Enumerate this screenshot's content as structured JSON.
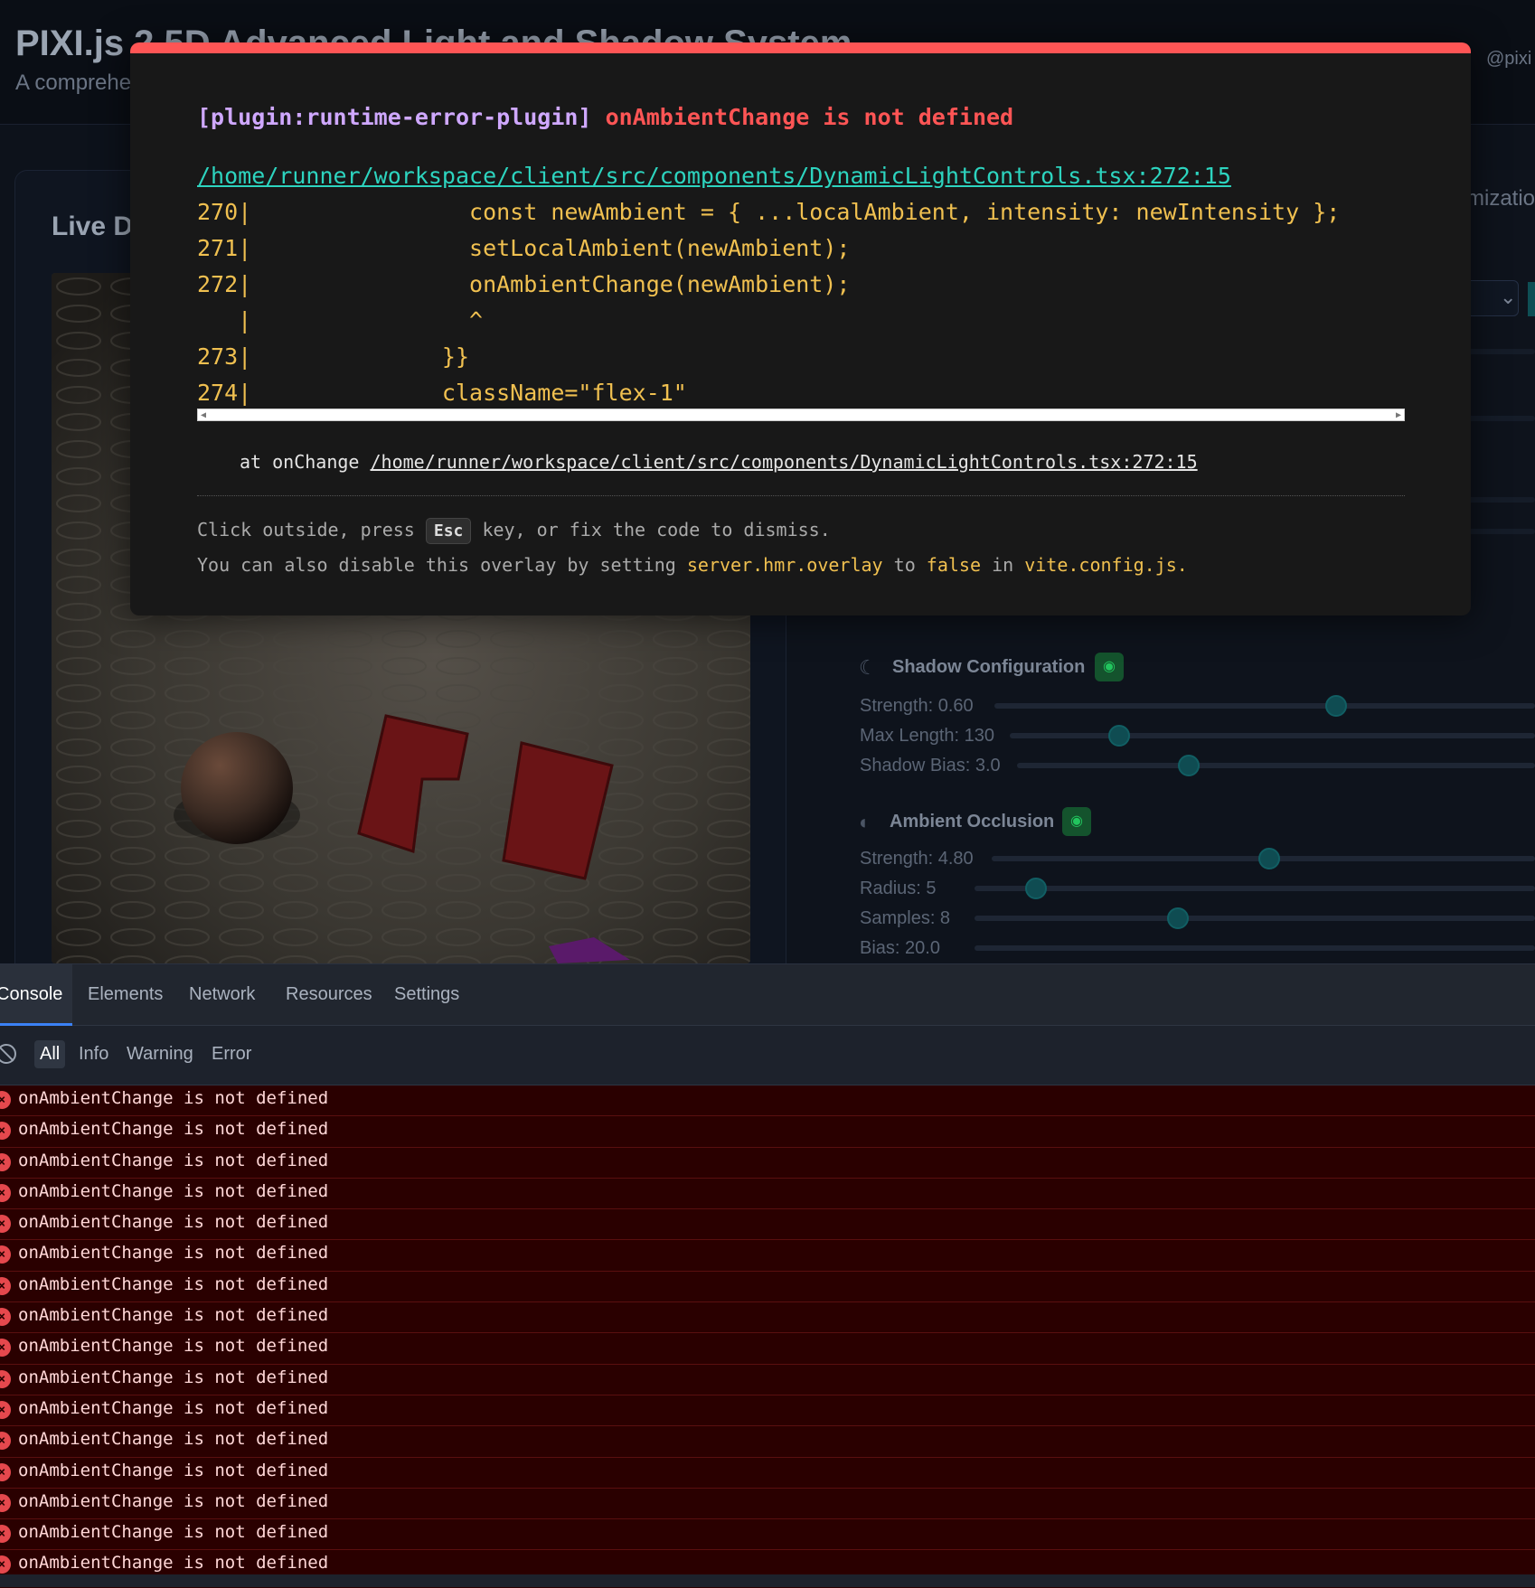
{
  "app": {
    "title": "PIXI.js 2.5D Advanced Light and Shadow System",
    "subtitle": "A comprehe",
    "user": "@pixi"
  },
  "left_panel": {
    "heading": "Live D"
  },
  "right_panel": {
    "tab_fragment": "mizatio"
  },
  "shadow_config": {
    "title": "Shadow Configuration",
    "sliders": [
      {
        "label": "Strength: 0.60",
        "value": 0.6
      },
      {
        "label": "Max Length: 130",
        "value": 130
      },
      {
        "label": "Shadow Bias: 3.0",
        "value": 3.0
      }
    ]
  },
  "ambient_occlusion": {
    "title": "Ambient Occlusion",
    "sliders": [
      {
        "label": "Strength: 4.80",
        "value": 4.8
      },
      {
        "label": "Radius: 5",
        "value": 5
      },
      {
        "label": "Samples: 8",
        "value": 8
      },
      {
        "label": "Bias: 20.0",
        "value": 20.0
      }
    ]
  },
  "overlay": {
    "plugin": "[plugin:runtime-error-plugin]",
    "message": "onAmbientChange is not defined",
    "file": "/home/runner/workspace/client/src/components/DynamicLightControls.tsx:272:15",
    "code_lines": [
      "270|                const newAmbient = { ...localAmbient, intensity: newIntensity };",
      "271|                setLocalAmbient(newAmbient);",
      "272|                onAmbientChange(newAmbient);",
      "   |                ^",
      "273|              }}",
      "274|              className=\"flex-1\""
    ],
    "stack_prefix": "at onChange",
    "stack_file": "/home/runner/workspace/client/src/components/DynamicLightControls.tsx:272:15",
    "tip1_pre": "Click outside, press",
    "tip1_key": "Esc",
    "tip1_post": "key, or fix the code to dismiss.",
    "tip2_pre": "You can also disable this overlay by setting",
    "tip2_setting": "server.hmr.overlay",
    "tip2_mid": "to",
    "tip2_value": "false",
    "tip2_in": "in",
    "tip2_file": "vite.config.js",
    "tip2_end": "."
  },
  "devtools": {
    "tabs": [
      "Console",
      "Elements",
      "Network",
      "Resources",
      "Settings"
    ],
    "active_tab": "Console",
    "filters": [
      "All",
      "Info",
      "Warning",
      "Error"
    ],
    "active_filter": "All",
    "log_entries": [
      "onAmbientChange is not defined",
      "onAmbientChange is not defined",
      "onAmbientChange is not defined",
      "onAmbientChange is not defined",
      "onAmbientChange is not defined",
      "onAmbientChange is not defined",
      "onAmbientChange is not defined",
      "onAmbientChange is not defined",
      "onAmbientChange is not defined",
      "onAmbientChange is not defined",
      "onAmbientChange is not defined",
      "onAmbientChange is not defined",
      "onAmbientChange is not defined",
      "onAmbientChange is not defined",
      "onAmbientChange is not defined",
      "onAmbientChange is not defined"
    ]
  },
  "colors": {
    "error_red": "#ff5555",
    "plugin_purple": "#cfa8ff",
    "link_teal": "#2dd4bf",
    "code_yellow": "#f0c050",
    "log_bg": "#2a0000"
  }
}
